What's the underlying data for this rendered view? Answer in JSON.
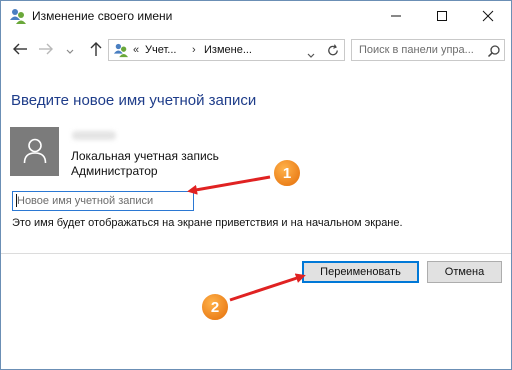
{
  "window": {
    "title": "Изменение своего имени"
  },
  "address_bar": {
    "separator": "«",
    "crumbs": [
      "Учет...",
      "Измене..."
    ],
    "crumb_separator": "›"
  },
  "search": {
    "placeholder": "Поиск в панели упра..."
  },
  "content": {
    "heading": "Введите новое имя учетной записи",
    "account_type": "Локальная учетная запись",
    "account_role": "Администратор",
    "new_name_placeholder": "Новое имя учетной записи",
    "new_name_value": "",
    "hint": "Это имя будет отображаться на экране приветствия и на начальном экране."
  },
  "buttons": {
    "rename": "Переименовать",
    "cancel": "Отмена"
  },
  "annotations": [
    {
      "label": "1",
      "color": "#f28a1e"
    },
    {
      "label": "2",
      "color": "#f28a1e"
    }
  ],
  "icons": {
    "app": "users-control-panel-icon",
    "minimize": "minimize-icon",
    "maximize": "maximize-icon",
    "close": "close-icon",
    "back": "arrow-left-icon",
    "forward": "arrow-right-icon",
    "recent": "chevron-down-icon",
    "up": "arrow-up-icon",
    "refresh": "refresh-icon",
    "search": "search-icon",
    "avatar": "user-avatar-icon"
  },
  "colors": {
    "heading": "#1f3d8a",
    "accent": "#0078d7",
    "annotation_arrow": "#e02222",
    "annotation_badge": "#f28a1e"
  }
}
